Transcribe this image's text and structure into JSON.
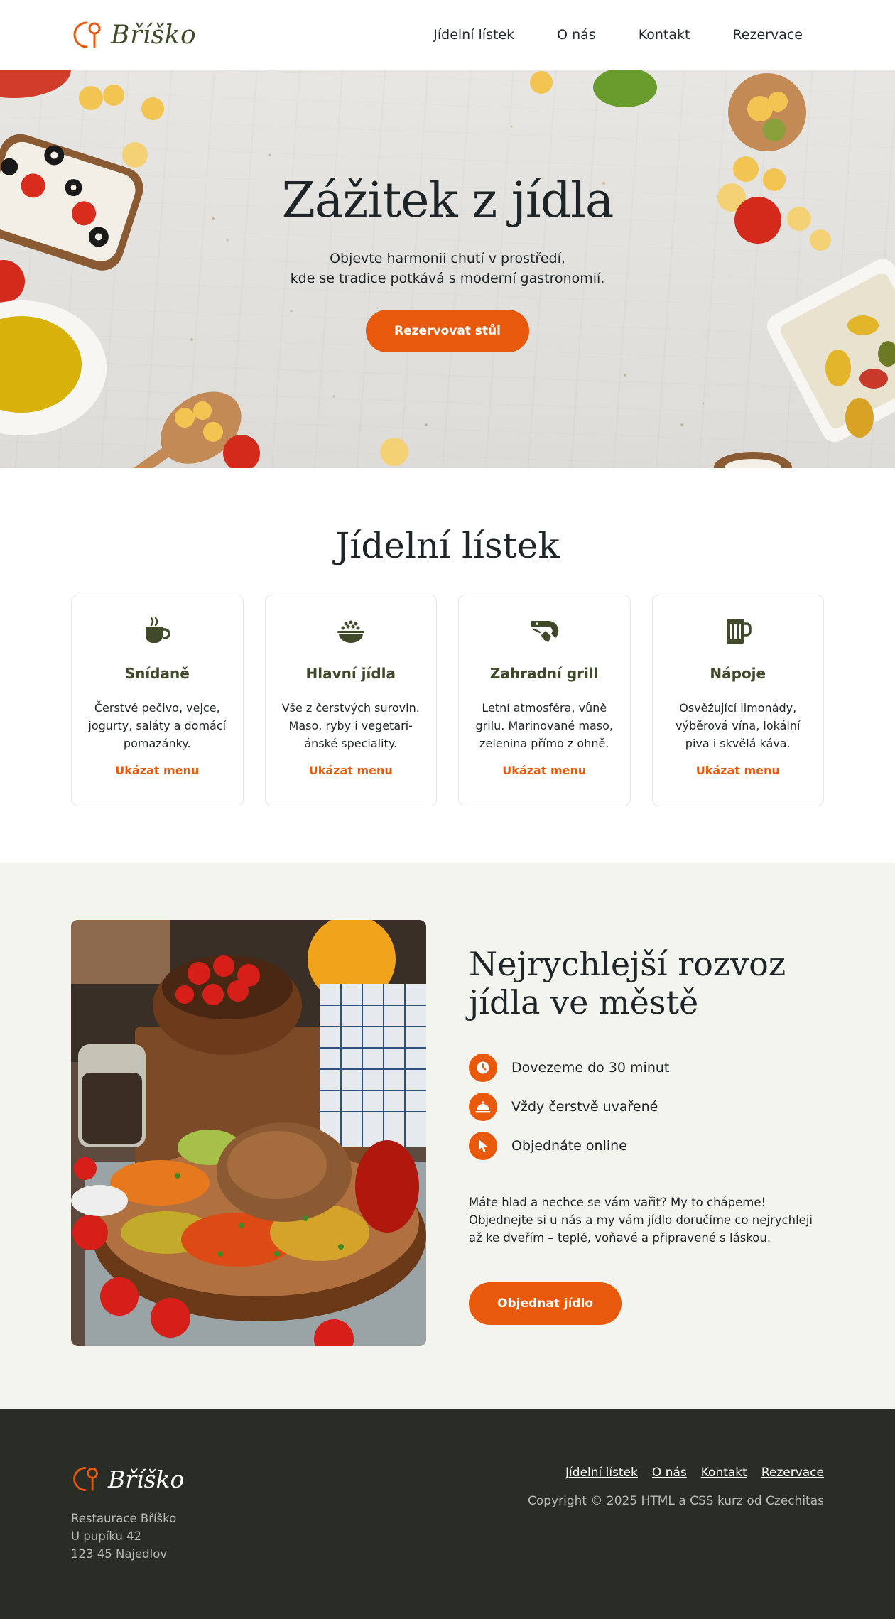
{
  "brand": {
    "name": "Bříško",
    "accent": "#e8590c",
    "olive": "#3f4a2a",
    "dark": "#2a2d26"
  },
  "nav": [
    "Jídelní lístek",
    "O nás",
    "Kontakt",
    "Rezervace"
  ],
  "hero": {
    "title": "Zážitek z jídla",
    "subtitle_line1": "Objevte harmonii chutí v prostředí,",
    "subtitle_line2": "kde se tradice potkává s moderní gastronomií.",
    "cta": "Rezervovat stůl"
  },
  "menu": {
    "title": "Jídelní lístek",
    "cards": [
      {
        "icon": "coffee-icon",
        "title": "Snídaně",
        "text": "Čerstvé pečivo, vejce, jogurty, saláty a domácí pomazánky.",
        "link": "Ukázat menu"
      },
      {
        "icon": "bowl-icon",
        "title": "Hlavní jídla",
        "text": "Vše z čerstvých surovin. Maso, ryby i vegetari-ánské speciality.",
        "link": "Ukázat menu"
      },
      {
        "icon": "shrimp-icon",
        "title": "Zahradní grill",
        "text": "Letní atmosféra, vůně grilu. Marinované maso, zelenina přímo z ohně.",
        "link": "Ukázat menu"
      },
      {
        "icon": "beer-mug-icon",
        "title": "Nápoje",
        "text": "Osvěžující limonády, výběrová vína, lokální piva i skvělá káva.",
        "link": "Ukázat menu"
      }
    ]
  },
  "delivery": {
    "title": "Nejrychlejší rozvoz jídla ve městě",
    "features": [
      {
        "icon": "clock-icon",
        "text": "Dovezeme do 30 minut"
      },
      {
        "icon": "cloche-icon",
        "text": "Vždy čerstvě uvařené"
      },
      {
        "icon": "cursor-icon",
        "text": "Objednáte online"
      }
    ],
    "text": "Máte hlad a nechce se vám vařit? My to chápeme! Objednejte si u nás a my vám jídlo doručíme co nejrychleji až ke dveřím – teplé, voňavé a připravené s láskou.",
    "cta": "Objednat jídlo"
  },
  "footer": {
    "brand": "Bříško",
    "address": [
      "Restaurace Bříško",
      "U pupíku 42",
      "123 45 Najedlov"
    ],
    "nav": [
      "Jídelní lístek",
      "O nás",
      "Kontakt",
      "Rezervace"
    ],
    "copyright": "Copyright © 2025 HTML a CSS kurz od Czechitas"
  }
}
